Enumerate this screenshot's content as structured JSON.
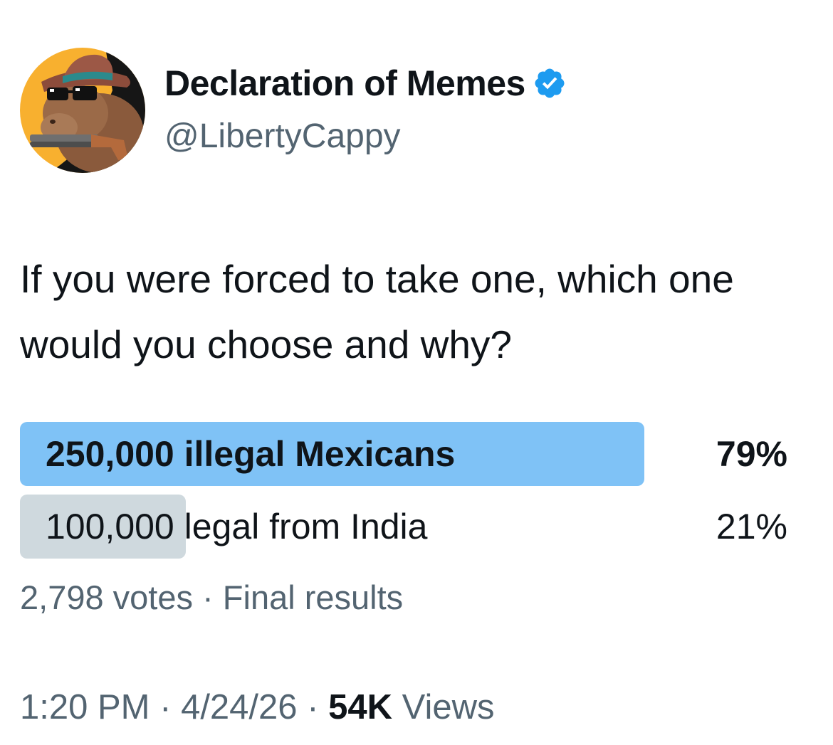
{
  "author": {
    "display_name": "Declaration of Memes",
    "handle": "@LibertyCappy",
    "verified": true,
    "verified_color": "#1d9bf0",
    "avatar": "capybara-cowboy-with-sunglasses-and-gun-avatar"
  },
  "tweet": {
    "text": "If you were forced to take one, which one would you choose and why?"
  },
  "poll": {
    "options": [
      {
        "label": "250,000 illegal Mexicans",
        "percent_text": "79%",
        "percent": 79,
        "fill_color": "#7fc2f6",
        "winner": true
      },
      {
        "label": "100,000 legal from India",
        "percent_text": "21%",
        "percent": 21,
        "fill_color": "#cfd9de",
        "winner": false
      }
    ],
    "votes": "2,798 votes",
    "separator": "·",
    "status": "Final results"
  },
  "meta": {
    "time": "1:20 PM",
    "date": "4/24/26",
    "views_count": "54K",
    "views_label": "Views",
    "separator": "·"
  }
}
